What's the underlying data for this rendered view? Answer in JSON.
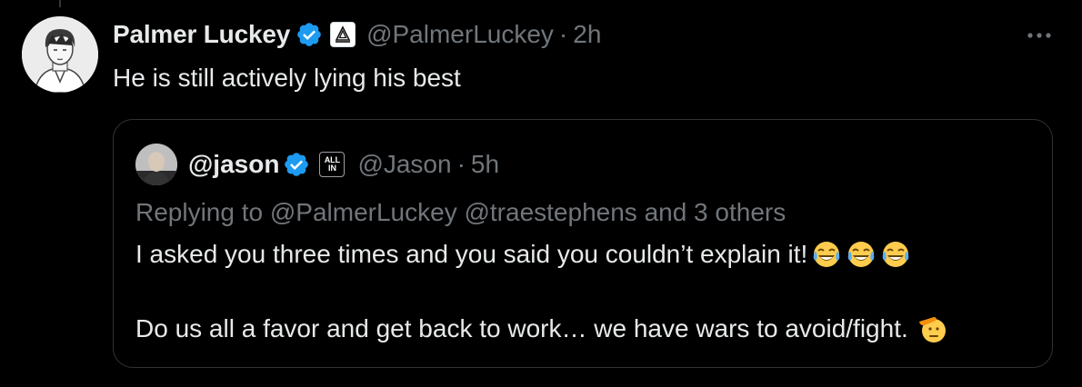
{
  "tweet": {
    "author_name": "Palmer Luckey",
    "author_handle": "@PalmerLuckey",
    "separator": "·",
    "time": "2h",
    "text": "He is still actively lying his best"
  },
  "quoted_tweet": {
    "author_name": "@jason",
    "author_handle": "@Jason",
    "separator": "·",
    "time": "5h",
    "affiliate_badge_text": [
      "ALL",
      "IN"
    ],
    "replying_to": "Replying to @PalmerLuckey @traestephens and 3 others",
    "line1": "I asked you three times and you said you couldn’t explain it!",
    "line2": "Do us all a favor and get back to work… we have wars to avoid/fight."
  },
  "icons": {
    "verified": "verified-badge-icon",
    "more": "more-options-icon",
    "laughing_emoji": "face-with-tears-of-joy-icon",
    "salute_emoji": "saluting-face-icon"
  },
  "colors": {
    "background": "#000000",
    "text_primary": "#e7e9ea",
    "text_secondary": "#71767b",
    "verified_blue": "#1d9bf0",
    "border": "#2f3336"
  }
}
